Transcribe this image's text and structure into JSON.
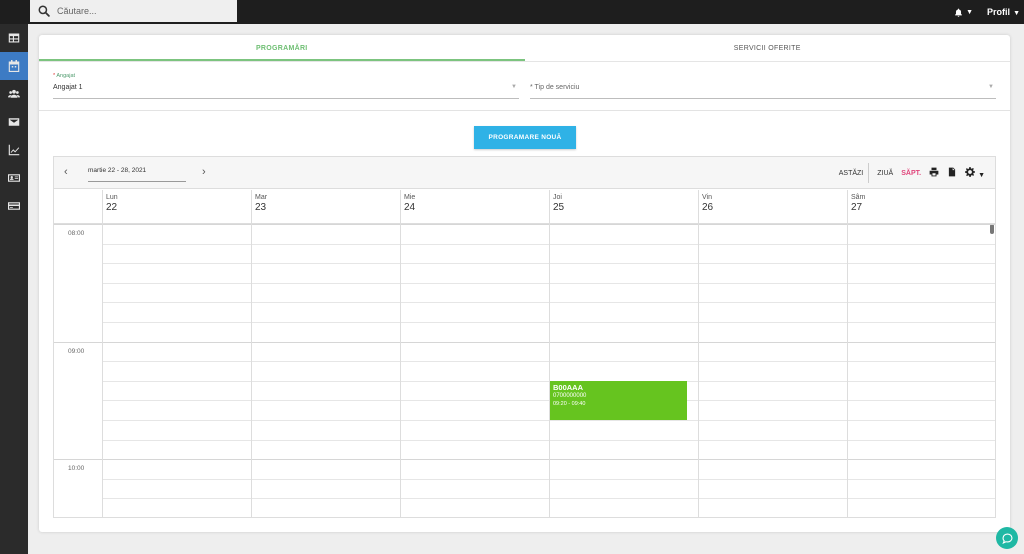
{
  "search": {
    "placeholder": "Căutare..."
  },
  "header": {
    "profile_label": "Profil"
  },
  "sidebar": {
    "items": [
      {
        "icon": "table-icon",
        "active": false
      },
      {
        "icon": "calendar-icon",
        "active": true
      },
      {
        "icon": "users-icon",
        "active": false
      },
      {
        "icon": "mail-icon",
        "active": false
      },
      {
        "icon": "chart-line-icon",
        "active": false
      },
      {
        "icon": "id-card-icon",
        "active": false
      },
      {
        "icon": "credit-card-icon",
        "active": false
      }
    ]
  },
  "tabs": [
    {
      "label": "PROGRAMĂRI",
      "active": true
    },
    {
      "label": "SERVICII OFERITE",
      "active": false
    }
  ],
  "form": {
    "employee": {
      "label": "Angajat",
      "value": "Angajat 1",
      "required_mark": "*"
    },
    "service": {
      "placeholder": "* Tip de serviciu"
    }
  },
  "new_appointment_label": "PROGRAMARE NOUĂ",
  "calendar": {
    "range": "martie 22 - 28, 2021",
    "today_label": "ASTĂZI",
    "day_label": "ZIUĂ",
    "week_label": "SĂPT.",
    "days": [
      {
        "name": "Lun",
        "num": "22"
      },
      {
        "name": "Mar",
        "num": "23"
      },
      {
        "name": "Mie",
        "num": "24"
      },
      {
        "name": "Joi",
        "num": "25"
      },
      {
        "name": "Vin",
        "num": "26"
      },
      {
        "name": "Sâm",
        "num": "27"
      }
    ],
    "hours": [
      "08:00",
      "09:00",
      "10:00"
    ],
    "event": {
      "title": "B00AAA",
      "phone": "0700000000",
      "time": "09:20 - 09:40",
      "color": "#66c41f"
    }
  },
  "colors": {
    "accent_green": "#6fbf73",
    "button_blue": "#2fb2e6",
    "week_pink": "#e0457b",
    "sidebar_active": "#3d7bc4"
  }
}
